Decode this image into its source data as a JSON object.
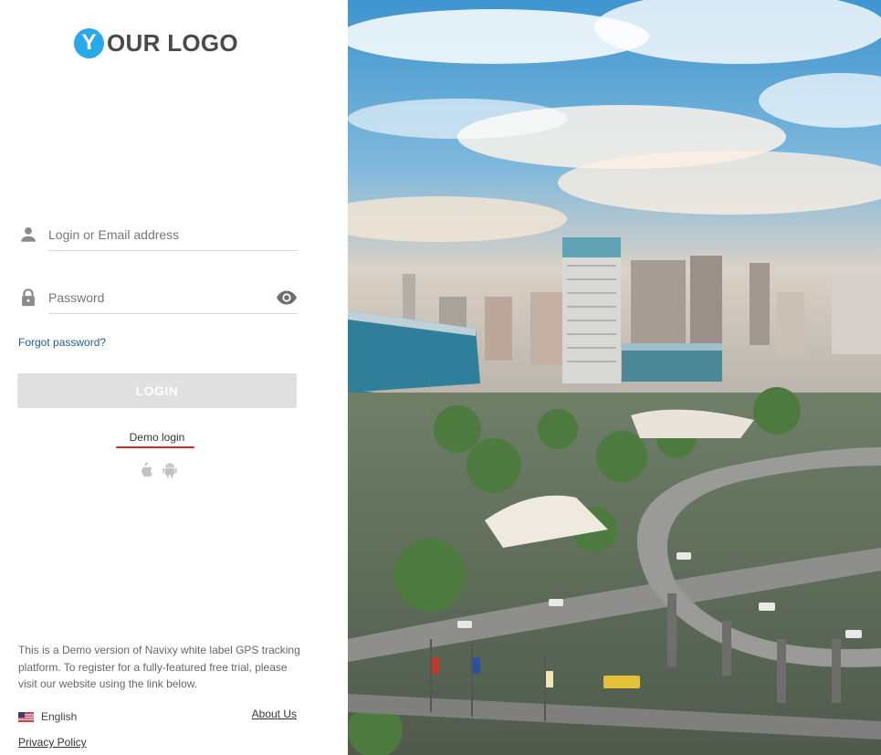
{
  "brand": {
    "logo_letter": "Y",
    "logo_text": "OUR LOGO",
    "accent_color": "#29a9e8"
  },
  "form": {
    "login_placeholder": "Login or Email address",
    "login_icon": "user-icon",
    "password_placeholder": "Password",
    "password_icon": "lock-icon",
    "show_password_icon": "eye-icon",
    "forgot_password": "Forgot password?",
    "login_button": "LOGIN",
    "demo_login": "Demo login"
  },
  "apps": {
    "icons": [
      "apple-icon",
      "android-icon"
    ]
  },
  "footer": {
    "note": "This is a Demo version of Navixy white label GPS tracking platform. To register for a fully-featured free trial, please visit our website using the link below.",
    "language": "English",
    "language_icon": "us-flag-icon",
    "about": "About Us",
    "privacy": "Privacy Policy"
  },
  "hero": {
    "description_icon": "city-photo"
  }
}
